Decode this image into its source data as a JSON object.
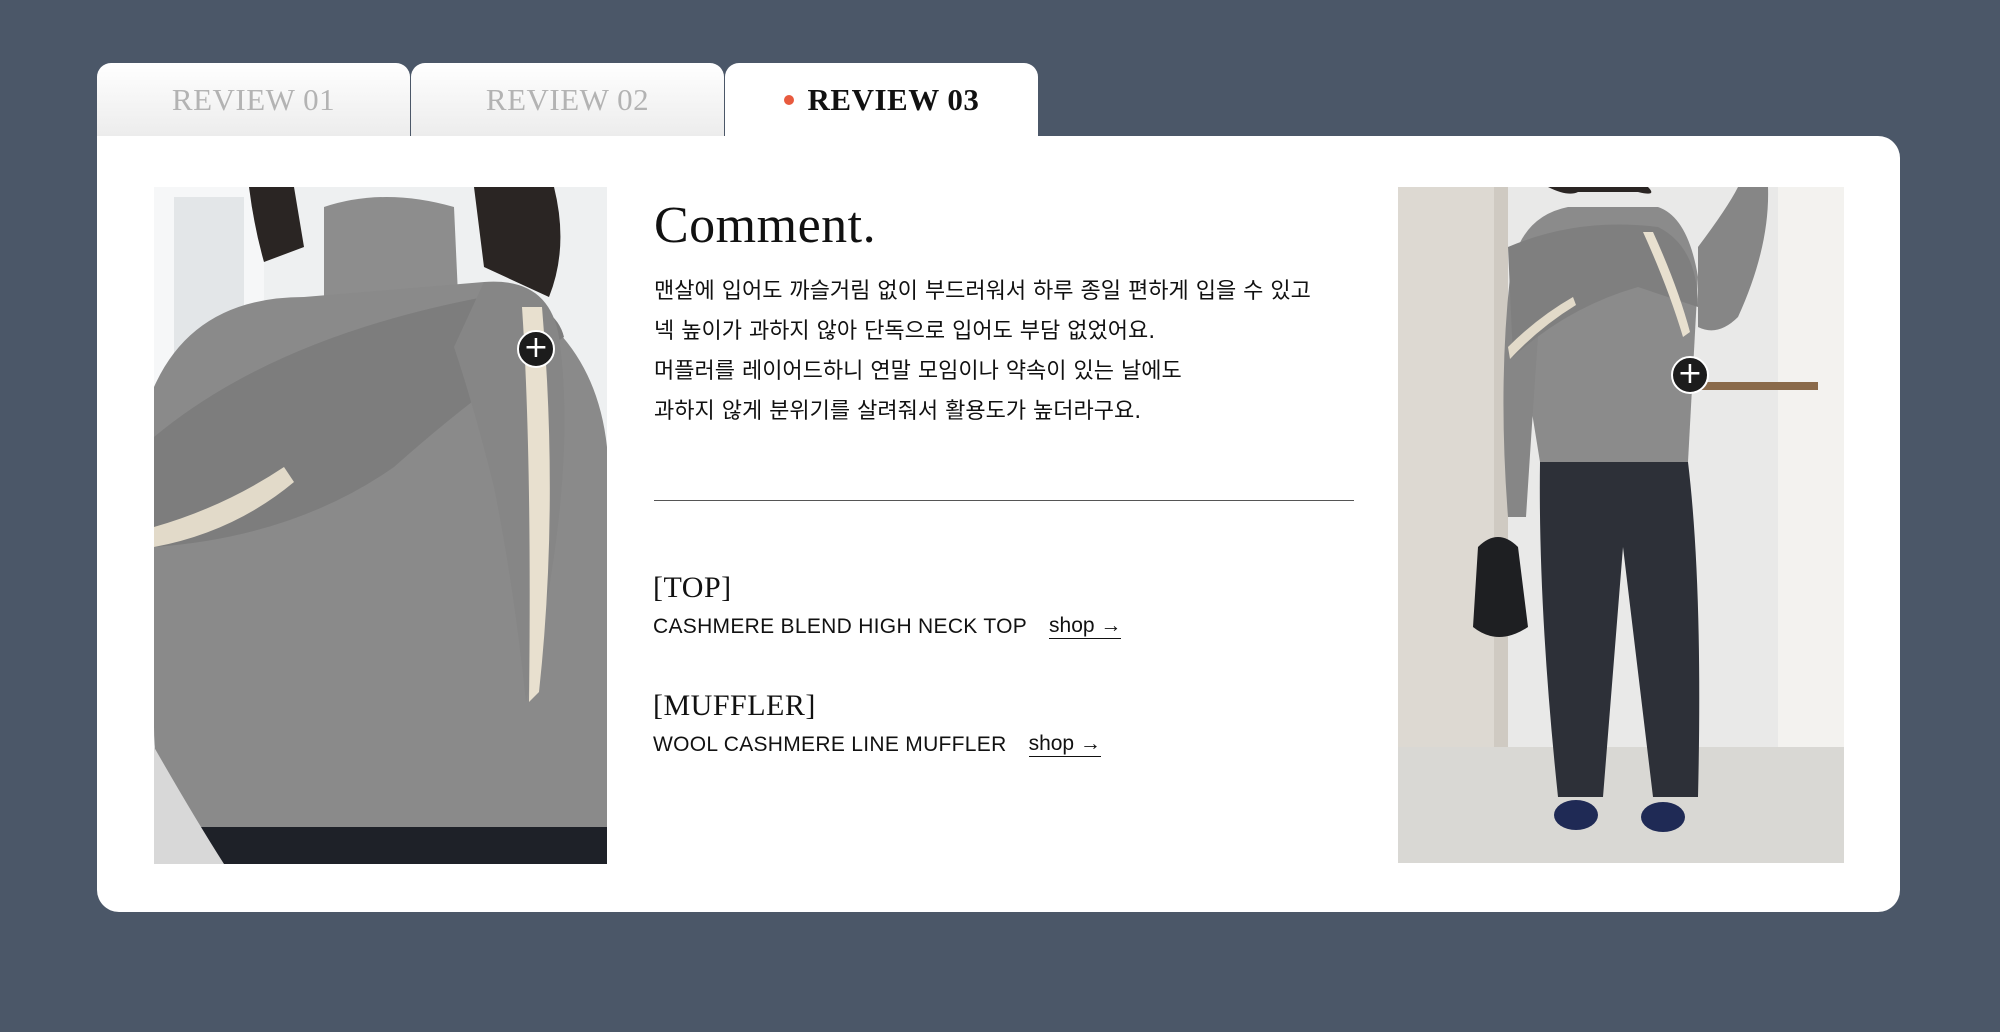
{
  "tabs": [
    {
      "label": "REVIEW 01",
      "active": false
    },
    {
      "label": "REVIEW 02",
      "active": false
    },
    {
      "label": "REVIEW 03",
      "active": true
    }
  ],
  "comment": {
    "title": "Comment.",
    "lines": [
      "맨살에 입어도 까슬거림 없이 부드러워서 하루 종일 편하게 입을 수 있고",
      "넥 높이가 과하지 않아 단독으로 입어도 부담 없었어요.",
      "머플러를 레이어드하니 연말 모임이나 약속이 있는 날에도",
      "과하지 않게 분위기를 살려줘서 활용도가 높더라구요."
    ]
  },
  "products": [
    {
      "category": "[TOP]",
      "name": "CASHMERE BLEND HIGH NECK TOP",
      "shop_label": "shop →"
    },
    {
      "category": "[MUFFLER]",
      "name": "WOOL CASHMERE LINE MUFFLER",
      "shop_label": "shop →"
    }
  ],
  "hotspot_symbol": "+",
  "colors": {
    "background": "#4b5768",
    "card": "#ffffff",
    "active_dot": "#e85a3e",
    "inactive_tab_text": "#b3b3b3"
  },
  "icons": [
    "plus-icon",
    "arrow-right-icon"
  ]
}
